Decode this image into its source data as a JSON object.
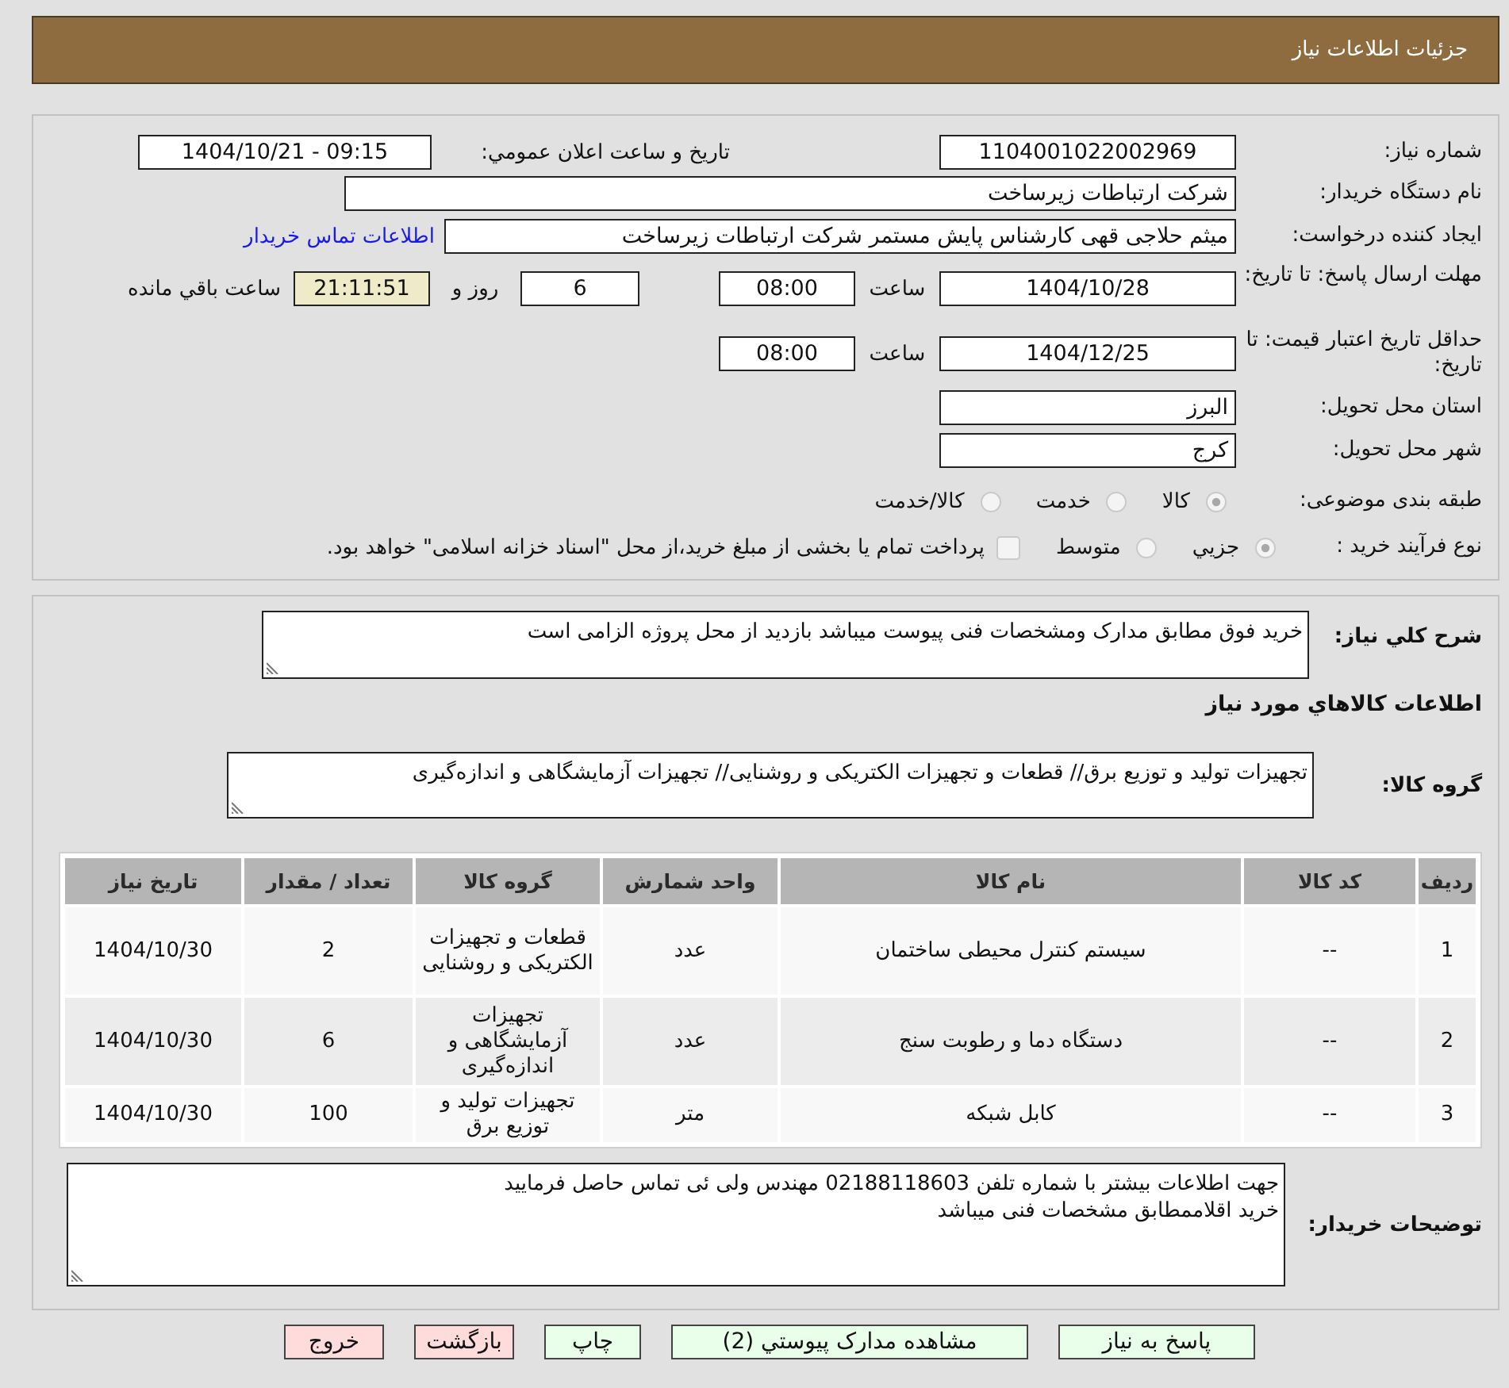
{
  "header": {
    "title": "جزئیات اطلاعات نیاز"
  },
  "details": {
    "need_number": {
      "label": "شماره نیاز:",
      "value": "1104001022002969"
    },
    "announcement": {
      "label": "تاریخ و ساعت اعلان عمومي:",
      "value": "1404/10/21 - 09:15"
    },
    "buyer_organization": {
      "label": "نام دستگاه خریدار:",
      "value": "شرکت ارتباطات زیرساخت"
    },
    "requester": {
      "label": "ایجاد کننده درخواست:",
      "value": "میثم حلاجی قهی کارشناس پایش مستمر شرکت ارتباطات زیرساخت",
      "contact_link": "اطلاعات تماس خریدار"
    },
    "response_deadline": {
      "label": "مهلت ارسال پاسخ: تا تاریخ:",
      "date": "1404/10/28",
      "time_label": "ساعت",
      "time": "08:00",
      "days": "6",
      "days_label": "روز و",
      "remaining": "21:11:51",
      "remaining_label": "ساعت باقي مانده"
    },
    "price_validity": {
      "label": "حداقل تاریخ اعتبار قیمت: تا تاریخ:",
      "date": "1404/12/25",
      "time_label": "ساعت",
      "time": "08:00"
    },
    "delivery_province": {
      "label": "استان محل تحویل:",
      "value": "البرز"
    },
    "delivery_city": {
      "label": "شهر محل تحویل:",
      "value": "کرج"
    },
    "subject_category": {
      "label": "طبقه بندی موضوعی:",
      "options": [
        {
          "label": "کالا",
          "selected": true
        },
        {
          "label": "خدمت",
          "selected": false
        },
        {
          "label": "کالا/خدمت",
          "selected": false
        }
      ]
    },
    "purchase_process": {
      "label": "نوع فرآیند خرید :",
      "options": [
        {
          "label": "جزيي",
          "selected": true
        },
        {
          "label": "متوسط",
          "selected": false
        }
      ],
      "treasury_option": {
        "label": "پرداخت تمام یا بخشی از مبلغ خرید،از محل \"اسناد خزانه اسلامی\" خواهد بود.",
        "checked": false
      }
    }
  },
  "summary": {
    "label": "شرح كلي نياز:",
    "value": "خرید فوق مطابق مدارک ومشخصات فنی پیوست میباشد بازدید از محل پروژه الزامی است"
  },
  "goods_heading": "اطلاعات كالاهاي مورد نياز",
  "goods_group": {
    "label": "گروه کالا:",
    "value": "تجهیزات تولید و توزیع برق// قطعات و تجهیزات الکتریکی و روشنایی// تجهیزات آزمایشگاهی و اندازه‌گیری"
  },
  "table": {
    "columns": [
      "ردیف",
      "کد کالا",
      "نام کالا",
      "واحد شمارش",
      "گروه کالا",
      "تعداد / مقدار",
      "تاریخ نیاز"
    ],
    "rows": [
      [
        "1",
        "--",
        "سیستم کنترل محیطی ساختمان",
        "عدد",
        "قطعات و تجهیزات الکتریکی و روشنایی",
        "2",
        "1404/10/30"
      ],
      [
        "2",
        "--",
        "دستگاه دما و رطوبت سنج",
        "عدد",
        "تجهیزات آزمایشگاهی و اندازه‌گیری",
        "6",
        "1404/10/30"
      ],
      [
        "3",
        "--",
        "کابل شبکه",
        "متر",
        "تجهیزات تولید و توزیع برق",
        "100",
        "1404/10/30"
      ]
    ]
  },
  "buyer_notes": {
    "label": "توضیحات خریدار:",
    "value": "جهت اطلاعات بیشتر با شماره تلفن 02188118603 مهندس ولی ئی تماس حاصل فرمایید\nخرید اقلاممطابق مشخصات فنی میباشد"
  },
  "buttons": [
    {
      "label": "پاسخ به نیاز",
      "color": "#eaffea"
    },
    {
      "label": "مشاهده مدارک پیوستي (2)",
      "color": "#eaffea"
    },
    {
      "label": "چاپ",
      "color": "#eaffea"
    },
    {
      "label": "بازگشت",
      "color": "#ffdcdc"
    },
    {
      "label": "خروج",
      "color": "#ffdcdc"
    }
  ]
}
